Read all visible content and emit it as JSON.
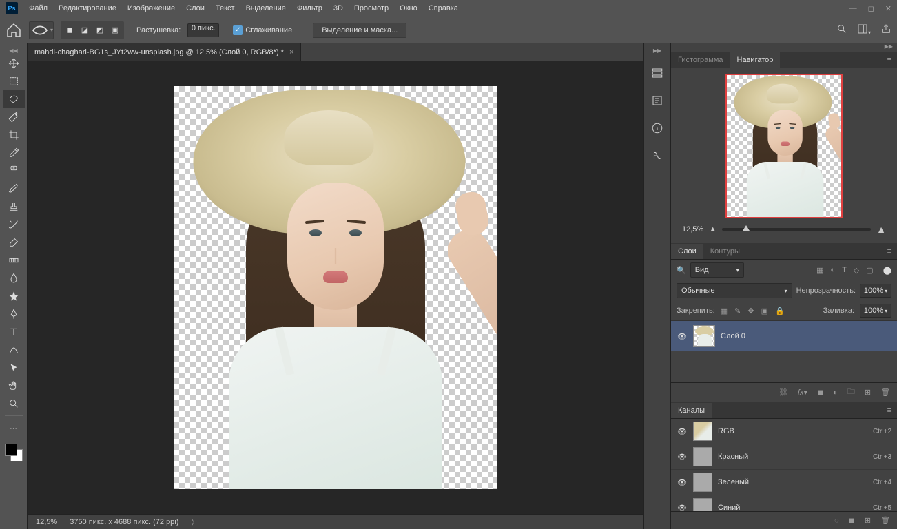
{
  "menubar": {
    "items": [
      "Файл",
      "Редактирование",
      "Изображение",
      "Слои",
      "Текст",
      "Выделение",
      "Фильтр",
      "3D",
      "Просмотр",
      "Окно",
      "Справка"
    ]
  },
  "options": {
    "feather_label": "Растушевка:",
    "feather_value": "0 пикс.",
    "antialias_label": "Сглаживание",
    "select_mask_btn": "Выделение и маска..."
  },
  "document": {
    "tab_title": "mahdi-chaghari-BG1s_JYt2ww-unsplash.jpg @ 12,5% (Слой 0, RGB/8*) *"
  },
  "status": {
    "zoom": "12,5%",
    "dims": "3750 пикс. x 4688 пикс. (72 ppi)"
  },
  "navigator": {
    "tab_histogram": "Гистограмма",
    "tab_navigator": "Навигатор",
    "zoom": "12,5%"
  },
  "layers": {
    "tab_layers": "Слои",
    "tab_paths": "Контуры",
    "kind_label": "Вид",
    "mode": "Обычные",
    "opacity_label": "Непрозрачность:",
    "opacity_value": "100%",
    "lock_label": "Закрепить:",
    "fill_label": "Заливка:",
    "fill_value": "100%",
    "layer0": "Слой 0"
  },
  "channels": {
    "tab": "Каналы",
    "items": [
      {
        "name": "RGB",
        "shortcut": "Ctrl+2"
      },
      {
        "name": "Красный",
        "shortcut": "Ctrl+3"
      },
      {
        "name": "Зеленый",
        "shortcut": "Ctrl+4"
      },
      {
        "name": "Синий",
        "shortcut": "Ctrl+5"
      }
    ]
  }
}
